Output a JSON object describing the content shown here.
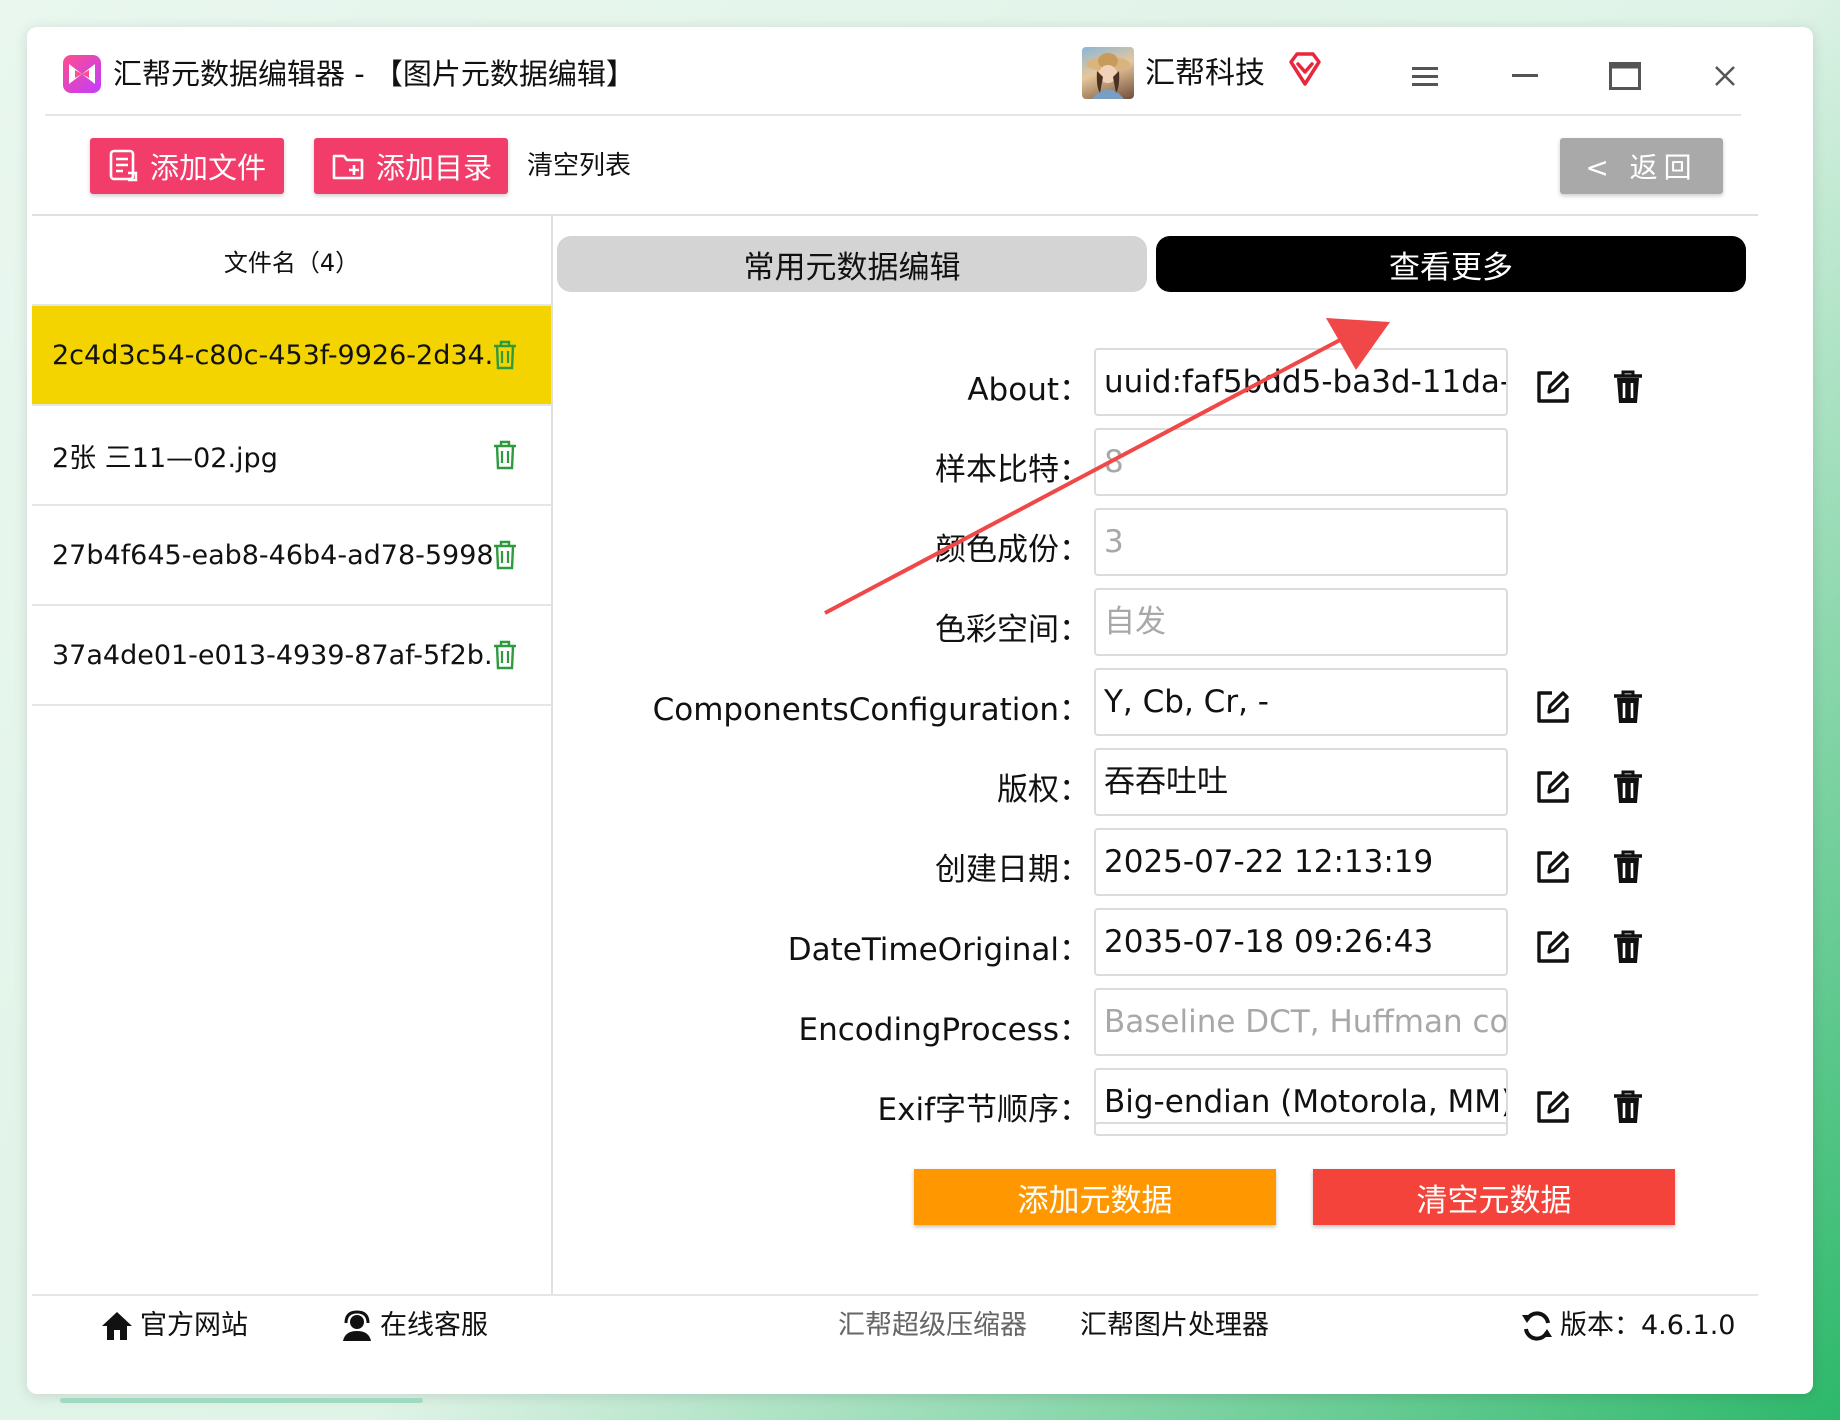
{
  "window": {
    "app_title": "汇帮元数据编辑器 - 【图片元数据编辑】",
    "user_name": "汇帮科技",
    "icons": [
      "app-logo-icon",
      "avatar",
      "vip-diamond-icon",
      "menu-icon",
      "minimize-icon",
      "maximize-icon",
      "close-icon"
    ]
  },
  "toolbar": {
    "add_file": "添加文件",
    "add_folder": "添加目录",
    "clear_list": "清空列表",
    "back": "< 返回"
  },
  "file_list": {
    "header": "文件名（4）",
    "items": [
      {
        "name": "2c4d3c54-c80c-453f-9926-2d34...",
        "active": true
      },
      {
        "name": "2张 三11—02.jpg",
        "active": false
      },
      {
        "name": "27b4f645-eab8-46b4-ad78-5998...",
        "active": false
      },
      {
        "name": "37a4de01-e013-4939-87af-5f2b...",
        "active": false
      }
    ]
  },
  "tabs": {
    "common": "常用元数据编辑",
    "more": "查看更多"
  },
  "fields": [
    {
      "label": "About：",
      "value": "uuid:faf5bdd5-ba3d-11da-",
      "editable": true
    },
    {
      "label": "样本比特：",
      "value": "8",
      "editable": false
    },
    {
      "label": "颜色成份：",
      "value": "3",
      "editable": false
    },
    {
      "label": "色彩空间：",
      "value": "自发",
      "editable": false
    },
    {
      "label": "ComponentsConfiguration：",
      "value": "Y, Cb, Cr, -",
      "editable": true
    },
    {
      "label": "版权：",
      "value": "吞吞吐吐",
      "editable": true
    },
    {
      "label": "创建日期：",
      "value": "2025-07-22 12:13:19",
      "editable": true
    },
    {
      "label": "DateTimeOriginal：",
      "value": "2035-07-18 09:26:43",
      "editable": true
    },
    {
      "label": "EncodingProcess：",
      "value": "Baseline DCT, Huffman coding",
      "editable": false
    },
    {
      "label": "Exif字节顺序：",
      "value": "Big-endian (Motorola, MM)",
      "editable": true
    }
  ],
  "actions": {
    "add_metadata": "添加元数据",
    "clear_metadata": "清空元数据"
  },
  "footer": {
    "website": "官方网站",
    "support": "在线客服",
    "compressor": "汇帮超级压缩器",
    "image_tool": "汇帮图片处理器",
    "version_label": "版本：",
    "version": "4.6.1.0"
  },
  "colors": {
    "pink": "#f23d6b",
    "active_row": "#f3d400",
    "orange": "#ff9800",
    "red": "#f4433a",
    "annotation_arrow": "#f04848"
  }
}
